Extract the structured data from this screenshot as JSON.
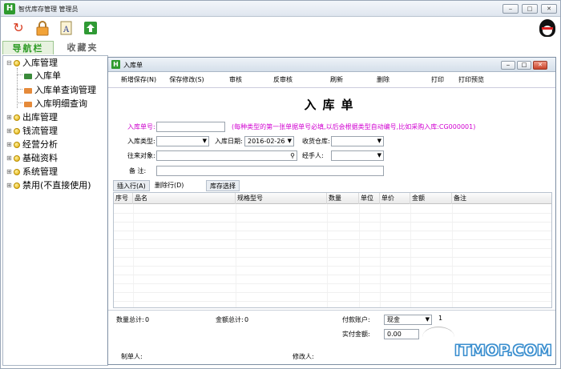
{
  "app": {
    "title": "智优库存管理 管理员",
    "logo_letter": "H",
    "window_buttons": [
      "‒",
      "□",
      "✕"
    ]
  },
  "toolbar": {
    "icons": [
      "refresh-icon",
      "lock-icon",
      "font-icon",
      "upload-icon",
      "qq-penguin-icon"
    ]
  },
  "nav_tabs": {
    "active": "导航栏",
    "inactive": "收藏夹"
  },
  "tree": {
    "groups": [
      {
        "label": "入库管理",
        "expanded": true,
        "children": [
          "入库单",
          "入库单查询管理",
          "入库明细查询"
        ]
      },
      {
        "label": "出库管理"
      },
      {
        "label": "钱流管理"
      },
      {
        "label": "经营分析"
      },
      {
        "label": "基础资料"
      },
      {
        "label": "系统管理"
      },
      {
        "label": "禁用(不直接使用)"
      }
    ]
  },
  "child_window": {
    "title": "入库单",
    "logo_letter": "H",
    "buttons": [
      "‒",
      "□",
      "✕"
    ]
  },
  "actions": [
    "新增保存(N)",
    "保存修改(S)",
    "审核",
    "反审核",
    "刷新",
    "删除",
    "打印",
    "打印预览"
  ],
  "form": {
    "title": "入库单",
    "order_no_label": "入库单号:",
    "order_no_value": "",
    "hint": "(每种类型的第一张单据单号必填,以后会根据类型自动编号,比如采购入库:CG000001)",
    "type_label": "入库类型:",
    "type_value": "",
    "date_label": "入库日期:",
    "date_value": "2016-02-26",
    "warehouse_label": "收货仓库:",
    "warehouse_value": "",
    "partner_label": "往来对象:",
    "partner_value": "",
    "handler_label": "经手人:",
    "handler_value": "",
    "remark_label": "备   注:",
    "remark_value": ""
  },
  "row_tabs": [
    "插入行(A)",
    "删除行(D)",
    "库存选择"
  ],
  "grid": {
    "columns": [
      "序号",
      "品名",
      "规格型号",
      "数量",
      "单位",
      "单价",
      "金额",
      "备注"
    ]
  },
  "footer": {
    "qty_label": "数量总计:",
    "qty_value": "0",
    "amount_label": "金额总计:",
    "amount_value": "0",
    "account_label": "付款账户:",
    "account_value": "现金",
    "account_extra": "1",
    "paid_label": "实付金额:",
    "paid_value": "0.00",
    "maker_label": "制单人:",
    "modifier_label": "修改人:"
  },
  "watermark": "ITMOP.COM"
}
